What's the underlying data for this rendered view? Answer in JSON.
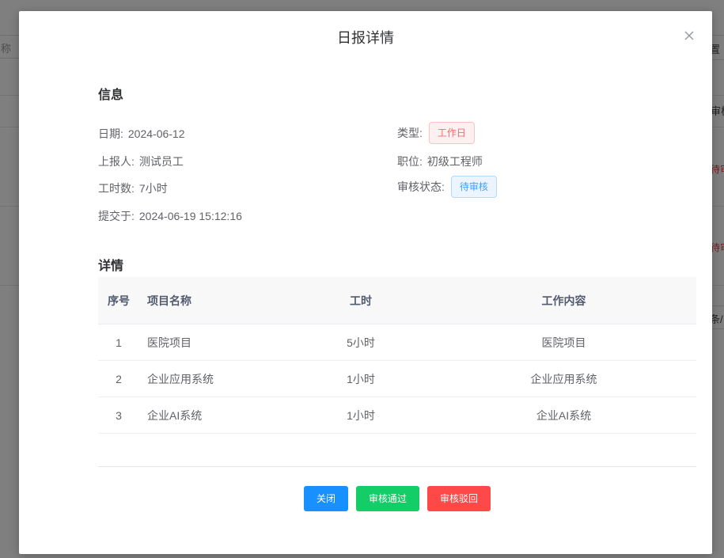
{
  "background": {
    "fragments": [
      "称",
      "置",
      "审核",
      "待审",
      "待审",
      "条/"
    ]
  },
  "modal": {
    "title": "日报详情",
    "close_icon": "close-icon"
  },
  "info": {
    "section_title": "信息",
    "date_label": "日期:",
    "date_value": "2024-06-12",
    "reporter_label": "上报人:",
    "reporter_value": "测试员工",
    "hours_label": "工时数:",
    "hours_value": "7小时",
    "submitted_label": "提交于:",
    "submitted_value": "2024-06-19 15:12:16",
    "type_label": "类型:",
    "type_value": "工作日",
    "position_label": "职位:",
    "position_value": "初级工程师",
    "status_label": "审核状态:",
    "status_value": "待审核"
  },
  "detail": {
    "section_title": "详情",
    "columns": [
      "序号",
      "项目名称",
      "工时",
      "工作内容"
    ],
    "rows": [
      {
        "index": "1",
        "project": "医院项目",
        "hours": "5小时",
        "content": "医院项目"
      },
      {
        "index": "2",
        "project": "企业应用系统",
        "hours": "1小时",
        "content": "企业应用系统"
      },
      {
        "index": "3",
        "project": "企业AI系统",
        "hours": "1小时",
        "content": "企业AI系统"
      }
    ]
  },
  "buttons": {
    "close": "关闭",
    "approve": "审核通过",
    "reject": "审核驳回"
  },
  "colors": {
    "primary": "#1890ff",
    "success": "#13ce66",
    "danger": "#ff4949"
  }
}
